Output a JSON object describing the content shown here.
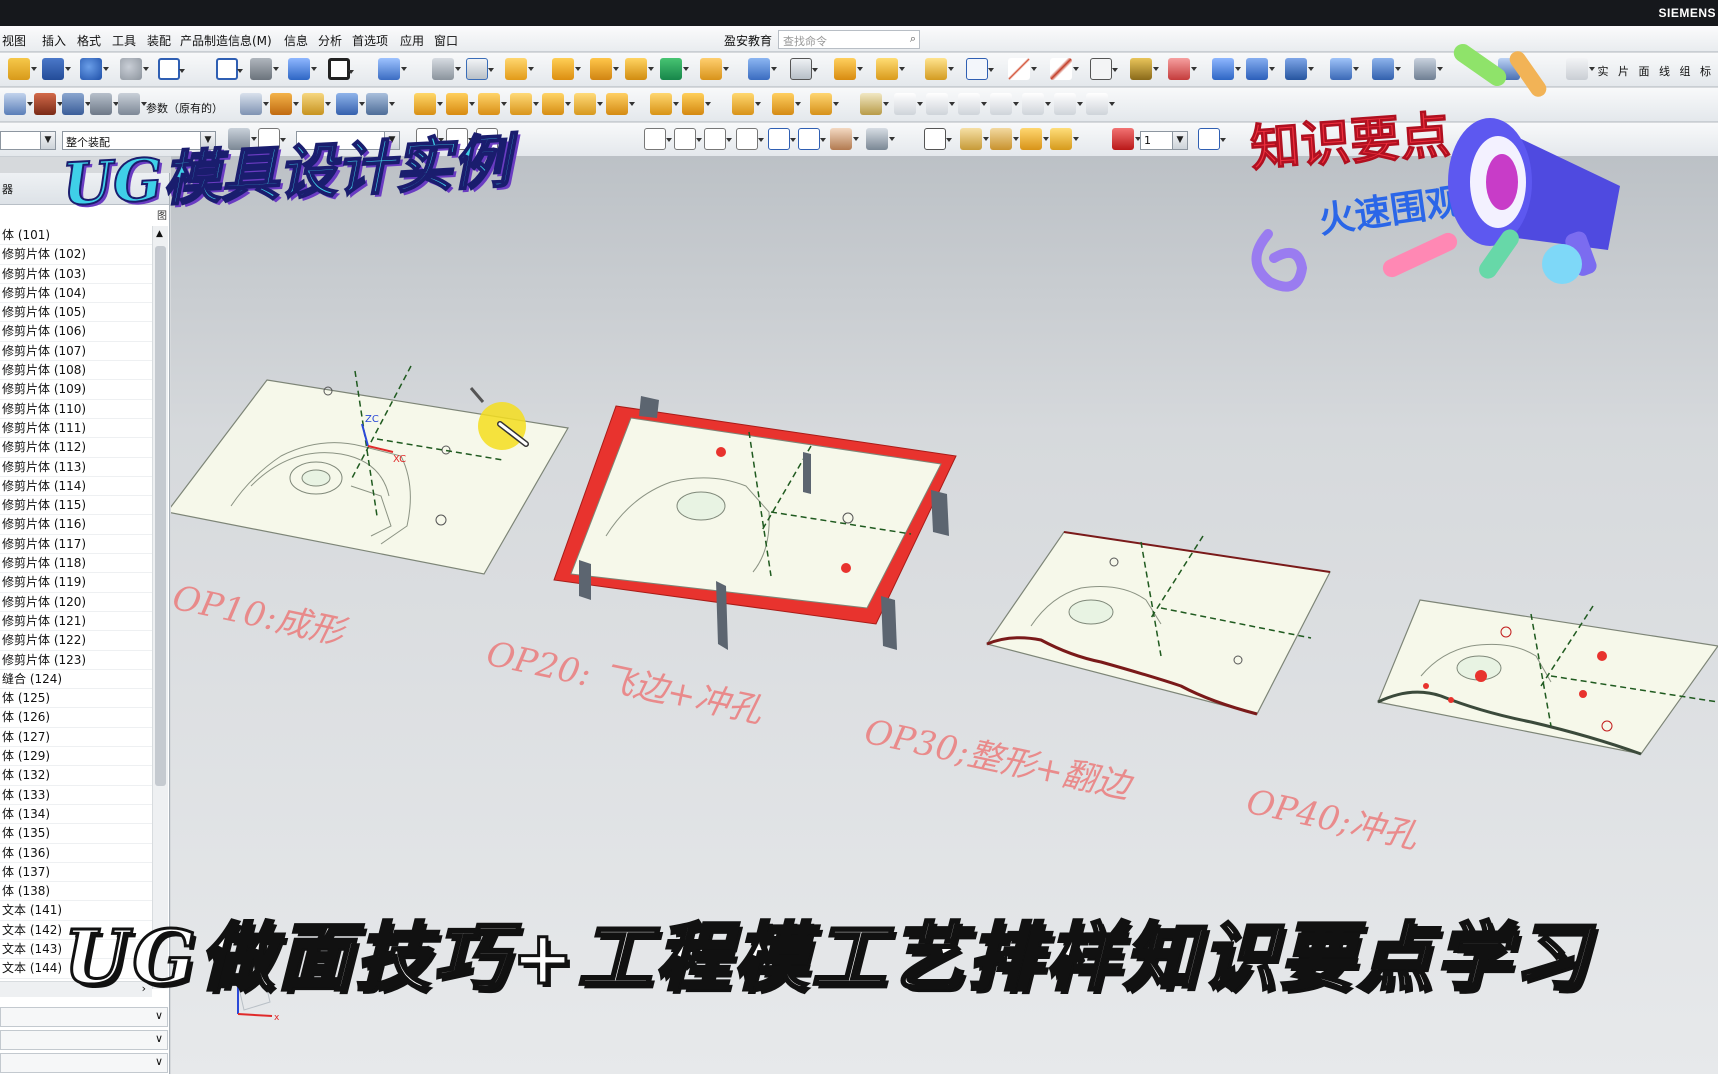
{
  "app": {
    "brand": "SIEMENS"
  },
  "menu": {
    "items": [
      "视图",
      "插入",
      "格式",
      "工具",
      "装配",
      "产品制造信息(M)",
      "信息",
      "分析",
      "首选项",
      "应用",
      "窗口"
    ],
    "edu_label": "盈安教育",
    "search_placeholder": "查找命令"
  },
  "toolbar": {
    "params_label": "参数（原有的）",
    "filter_value": "",
    "scope_value": "整个装配",
    "layer_value": "1",
    "right_labels": "实 片 面 线 组 标"
  },
  "navigator": {
    "header_label": "器",
    "column_tag": "图",
    "items": [
      "体 (101)",
      "修剪片体 (102)",
      "修剪片体 (103)",
      "修剪片体 (104)",
      "修剪片体 (105)",
      "修剪片体 (106)",
      "修剪片体 (107)",
      "修剪片体 (108)",
      "修剪片体 (109)",
      "修剪片体 (110)",
      "修剪片体 (111)",
      "修剪片体 (112)",
      "修剪片体 (113)",
      "修剪片体 (114)",
      "修剪片体 (115)",
      "修剪片体 (116)",
      "修剪片体 (117)",
      "修剪片体 (118)",
      "修剪片体 (119)",
      "修剪片体 (120)",
      "修剪片体 (121)",
      "修剪片体 (122)",
      "修剪片体 (123)",
      "缝合 (124)",
      "体 (125)",
      "体 (126)",
      "体 (127)",
      "体 (129)",
      "体 (132)",
      "体 (133)",
      "体 (134)",
      "体 (135)",
      "体 (136)",
      "体 (137)",
      "体 (138)",
      "文本 (141)",
      "文本 (142)",
      "文本 (143)",
      "文本 (144)"
    ]
  },
  "viewport": {
    "operations": [
      "OP10:成形",
      "OP20:   飞边+冲孔",
      "OP30;整形+翻边",
      "OP40;冲孔"
    ],
    "axis_labels": {
      "zc": "ZC",
      "xc": "XC",
      "x": "x"
    },
    "trim_color": "#e8332e",
    "part_color": "#f4f6e6"
  },
  "overlay": {
    "top_banner": "UG模具设计实例",
    "sticker_main": "知识要点",
    "sticker_sub": "火速围观",
    "bottom_banner": "UG做面技巧+工程模工艺排样知识要点学习",
    "accent": "#3fd0e8"
  }
}
